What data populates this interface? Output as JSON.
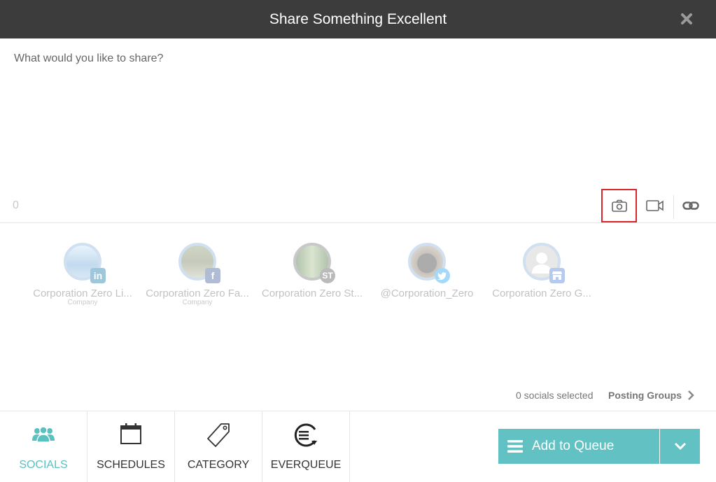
{
  "header": {
    "title": "Share Something Excellent"
  },
  "composer": {
    "placeholder": "What would you like to share?",
    "char_count": "0"
  },
  "socials": [
    {
      "name": "Corporation Zero Li...",
      "sub": "Company",
      "network": "in",
      "badge_color": "#0e76a8"
    },
    {
      "name": "Corporation Zero Fa...",
      "sub": "Company",
      "network": "f",
      "badge_color": "#3b5998"
    },
    {
      "name": "Corporation Zero St...",
      "sub": "",
      "network": "ST",
      "badge_color": "#555555"
    },
    {
      "name": "@Corporation_Zero",
      "sub": "",
      "network": "twitter",
      "badge_color": "#1da1f2"
    },
    {
      "name": "Corporation Zero G...",
      "sub": "",
      "network": "gmb",
      "badge_color": "#4a7bd8"
    }
  ],
  "selection": {
    "count_text": "0 socials selected",
    "posting_groups": "Posting Groups"
  },
  "tabs": [
    {
      "label": "SOCIALS",
      "icon": "users-icon",
      "active": true
    },
    {
      "label": "SCHEDULES",
      "icon": "calendar-icon",
      "active": false
    },
    {
      "label": "CATEGORY",
      "icon": "tag-icon",
      "active": false
    },
    {
      "label": "EVERQUEUE",
      "icon": "everqueue-icon",
      "active": false
    }
  ],
  "actions": {
    "add_to_queue": "Add to Queue"
  },
  "colors": {
    "accent": "#62c1c3",
    "header": "#3c3c3c",
    "highlight": "#d9262c"
  }
}
